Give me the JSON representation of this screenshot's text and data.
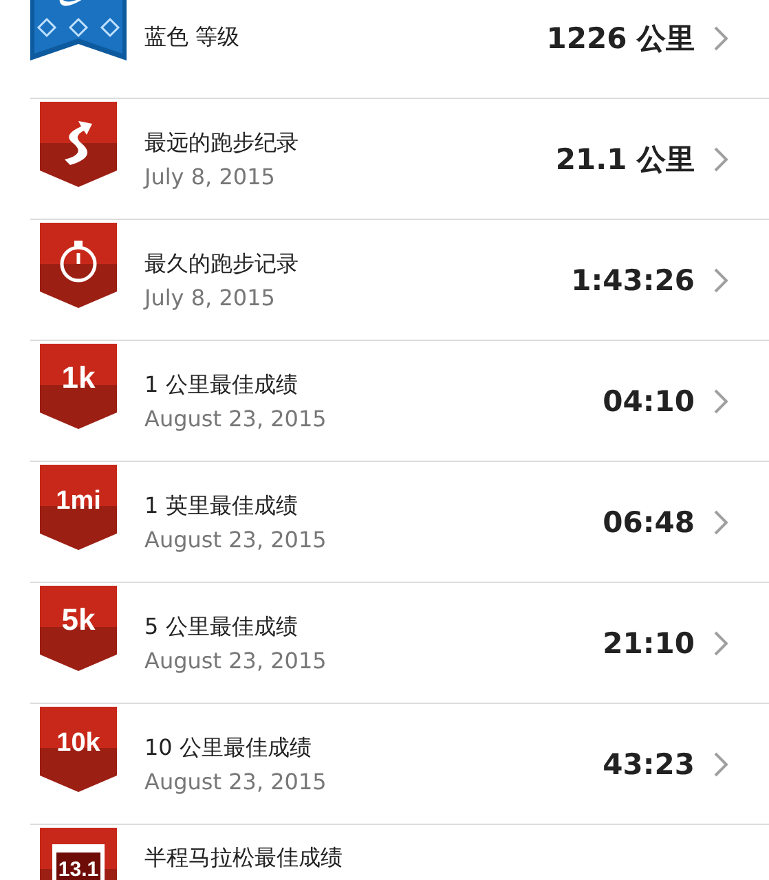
{
  "records": [
    {
      "kind": "level",
      "color": "#1a72c0",
      "title": "蓝色 等级",
      "value": "1226 公里"
    },
    {
      "kind": "route",
      "color": "#c8281a",
      "title": "最远的跑步纪录",
      "date": "July 8, 2015",
      "value": "21.1 公里"
    },
    {
      "kind": "stopwatch",
      "color": "#c8281a",
      "title": "最久的跑步记录",
      "date": "July 8, 2015",
      "value": "1:43:26"
    },
    {
      "kind": "text",
      "color": "#c8281a",
      "badge": "1k",
      "title": "1 公里最佳成绩",
      "date": "August 23, 2015",
      "value": "04:10"
    },
    {
      "kind": "text",
      "color": "#c8281a",
      "badge": "1mi",
      "title": "1 英里最佳成绩",
      "date": "August 23, 2015",
      "value": "06:48"
    },
    {
      "kind": "text",
      "color": "#c8281a",
      "badge": "5k",
      "title": "5 公里最佳成绩",
      "date": "August 23, 2015",
      "value": "21:10"
    },
    {
      "kind": "text",
      "color": "#c8281a",
      "badge": "10k",
      "title": "10 公里最佳成绩",
      "date": "August 23, 2015",
      "value": "43:23"
    },
    {
      "kind": "plate",
      "color": "#c8281a",
      "badge": "13.1",
      "title": "半程马拉松最佳成绩"
    }
  ]
}
